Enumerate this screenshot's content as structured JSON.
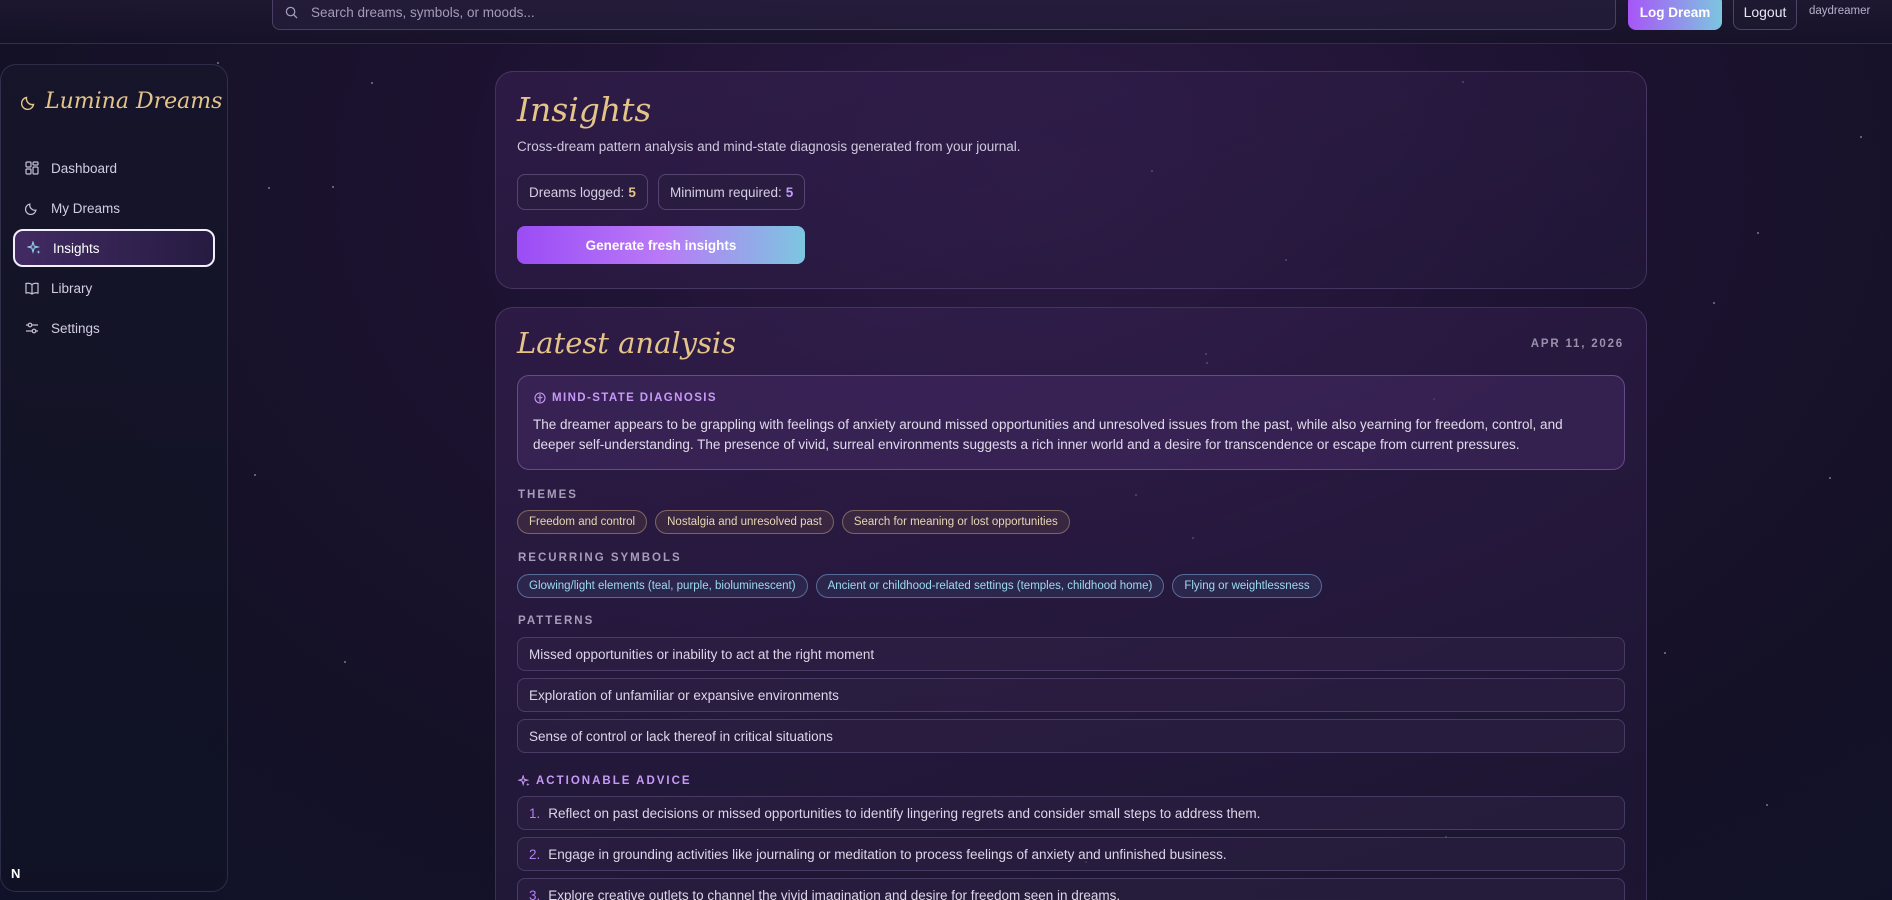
{
  "header": {
    "search_placeholder": "Search dreams, symbols, or moods...",
    "log_button": "Log Dream",
    "logout_button": "Logout",
    "username": "daydreamer"
  },
  "sidebar": {
    "brand": "Lumina Dreams",
    "items": [
      {
        "label": "Dashboard",
        "icon": "dashboard-icon"
      },
      {
        "label": "My Dreams",
        "icon": "moon-icon"
      },
      {
        "label": "Insights",
        "icon": "sparkles-icon",
        "active": true
      },
      {
        "label": "Library",
        "icon": "book-icon"
      },
      {
        "label": "Settings",
        "icon": "settings-icon"
      }
    ],
    "footer_mark": "N"
  },
  "insights": {
    "title": "Insights",
    "subtitle": "Cross-dream pattern analysis and mind-state diagnosis generated from your journal.",
    "dreams_logged_label": "Dreams logged:",
    "dreams_logged_value": "5",
    "minimum_label": "Minimum required:",
    "minimum_value": "5",
    "generate_button": "Generate fresh insights"
  },
  "analysis": {
    "title": "Latest analysis",
    "date": "APR 11, 2026",
    "diagnosis_label": "MIND-STATE DIAGNOSIS",
    "diagnosis_text": "The dreamer appears to be grappling with feelings of anxiety around missed opportunities and unresolved issues from the past, while also yearning for freedom, control, and deeper self-understanding. The presence of vivid, surreal environments suggests a rich inner world and a desire for transcendence or escape from current pressures.",
    "themes_label": "THEMES",
    "themes": [
      "Freedom and control",
      "Nostalgia and unresolved past",
      "Search for meaning or lost opportunities"
    ],
    "symbols_label": "RECURRING SYMBOLS",
    "symbols": [
      "Glowing/light elements (teal, purple, bioluminescent)",
      "Ancient or childhood-related settings (temples, childhood home)",
      "Flying or weightlessness"
    ],
    "patterns_label": "PATTERNS",
    "patterns": [
      "Missed opportunities or inability to act at the right moment",
      "Exploration of unfamiliar or expansive environments",
      "Sense of control or lack thereof in critical situations"
    ],
    "advice_label": "ACTIONABLE ADVICE",
    "advice": [
      {
        "num": "1.",
        "text": "Reflect on past decisions or missed opportunities to identify lingering regrets and consider small steps to address them."
      },
      {
        "num": "2.",
        "text": "Engage in grounding activities like journaling or meditation to process feelings of anxiety and unfinished business."
      },
      {
        "num": "3.",
        "text": "Explore creative outlets to channel the vivid imagination and desire for freedom seen in dreams."
      }
    ]
  },
  "colors": {
    "accent_gold": "#e5c48a",
    "accent_purple": "#c79af7",
    "accent_teal": "#7cc6e0"
  }
}
